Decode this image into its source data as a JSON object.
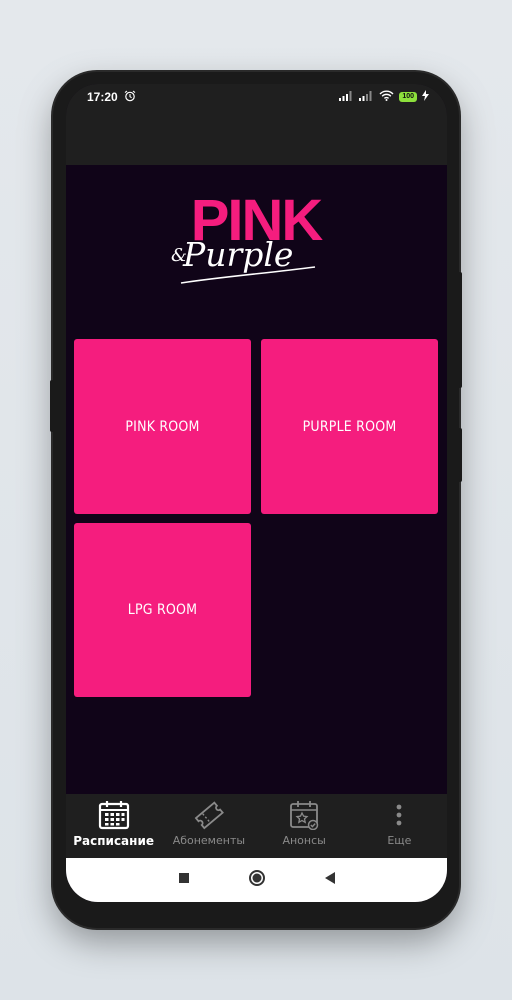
{
  "status": {
    "time": "17:20",
    "battery": "100"
  },
  "logo": {
    "title": "PINK",
    "script": "Purple",
    "amp": "&"
  },
  "rooms": [
    {
      "label": "PINK ROOM"
    },
    {
      "label": "PURPLE ROOM"
    },
    {
      "label": "LPG ROOM"
    }
  ],
  "nav": {
    "items": [
      {
        "label": "Расписание",
        "icon": "calendar-icon",
        "active": true
      },
      {
        "label": "Абонементы",
        "icon": "ticket-icon",
        "active": false
      },
      {
        "label": "Анонсы",
        "icon": "calendar-star-icon",
        "active": false
      },
      {
        "label": "Еще",
        "icon": "more-vertical-icon",
        "active": false
      }
    ]
  },
  "colors": {
    "accent": "#f51d7e",
    "background": "#100418",
    "bar": "#1f1f1f",
    "battery": "#8de03c"
  }
}
